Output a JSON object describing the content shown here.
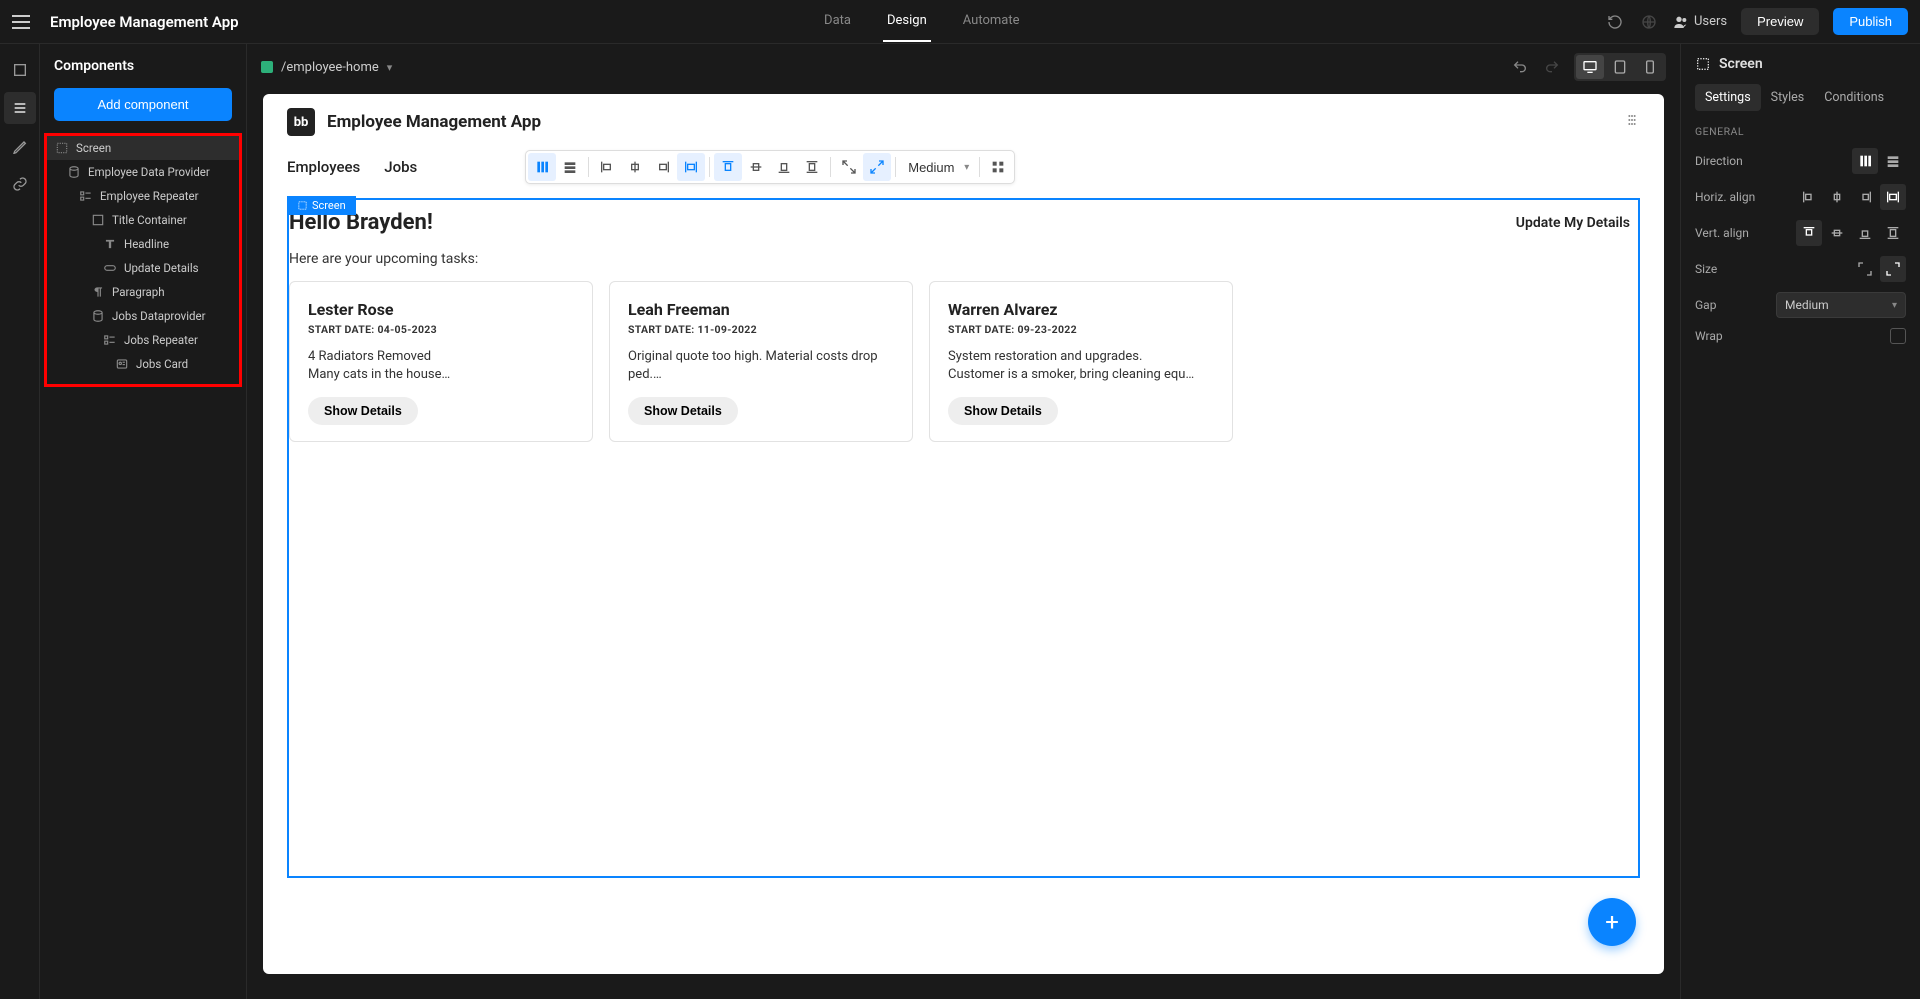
{
  "topbar": {
    "app_title": "Employee Management App",
    "tabs": {
      "data": "Data",
      "design": "Design",
      "automate": "Automate"
    },
    "users": "Users",
    "preview": "Preview",
    "publish": "Publish"
  },
  "leftpanel": {
    "header": "Components",
    "add_component": "Add component",
    "tree": {
      "screen": "Screen",
      "emp_data": "Employee Data Provider",
      "emp_rep": "Employee Repeater",
      "title_cont": "Title Container",
      "headline": "Headline",
      "update": "Update Details",
      "paragraph": "Paragraph",
      "jobs_data": "Jobs Dataprovider",
      "jobs_rep": "Jobs Repeater",
      "jobs_card": "Jobs Card"
    }
  },
  "canvas": {
    "route": "/employee-home",
    "title": "Employee Management App",
    "nav": {
      "employees": "Employees",
      "jobs": "Jobs"
    },
    "gap_select": "Medium",
    "screen_label": "Screen",
    "hello": "Hello Brayden!",
    "update_details": "Update My Details",
    "subtext": "Here are your upcoming tasks:",
    "cards": [
      {
        "name": "Lester Rose",
        "date": "START DATE: 04-05-2023",
        "body": "4 Radiators Removed\nMany cats in the house…",
        "btn": "Show Details"
      },
      {
        "name": "Leah Freeman",
        "date": "START DATE: 11-09-2022",
        "body": "Original quote too high. Material costs drop\nped.…",
        "btn": "Show Details"
      },
      {
        "name": "Warren Alvarez",
        "date": "START DATE: 09-23-2022",
        "body": "System restoration and upgrades.\nCustomer is a smoker, bring cleaning equ…",
        "btn": "Show Details"
      }
    ]
  },
  "rightpanel": {
    "title": "Screen",
    "tabs": {
      "settings": "Settings",
      "styles": "Styles",
      "conditions": "Conditions"
    },
    "section": "GENERAL",
    "rows": {
      "direction": "Direction",
      "halign": "Horiz. align",
      "valign": "Vert. align",
      "size": "Size",
      "gap": "Gap",
      "wrap": "Wrap"
    },
    "gap_value": "Medium"
  }
}
